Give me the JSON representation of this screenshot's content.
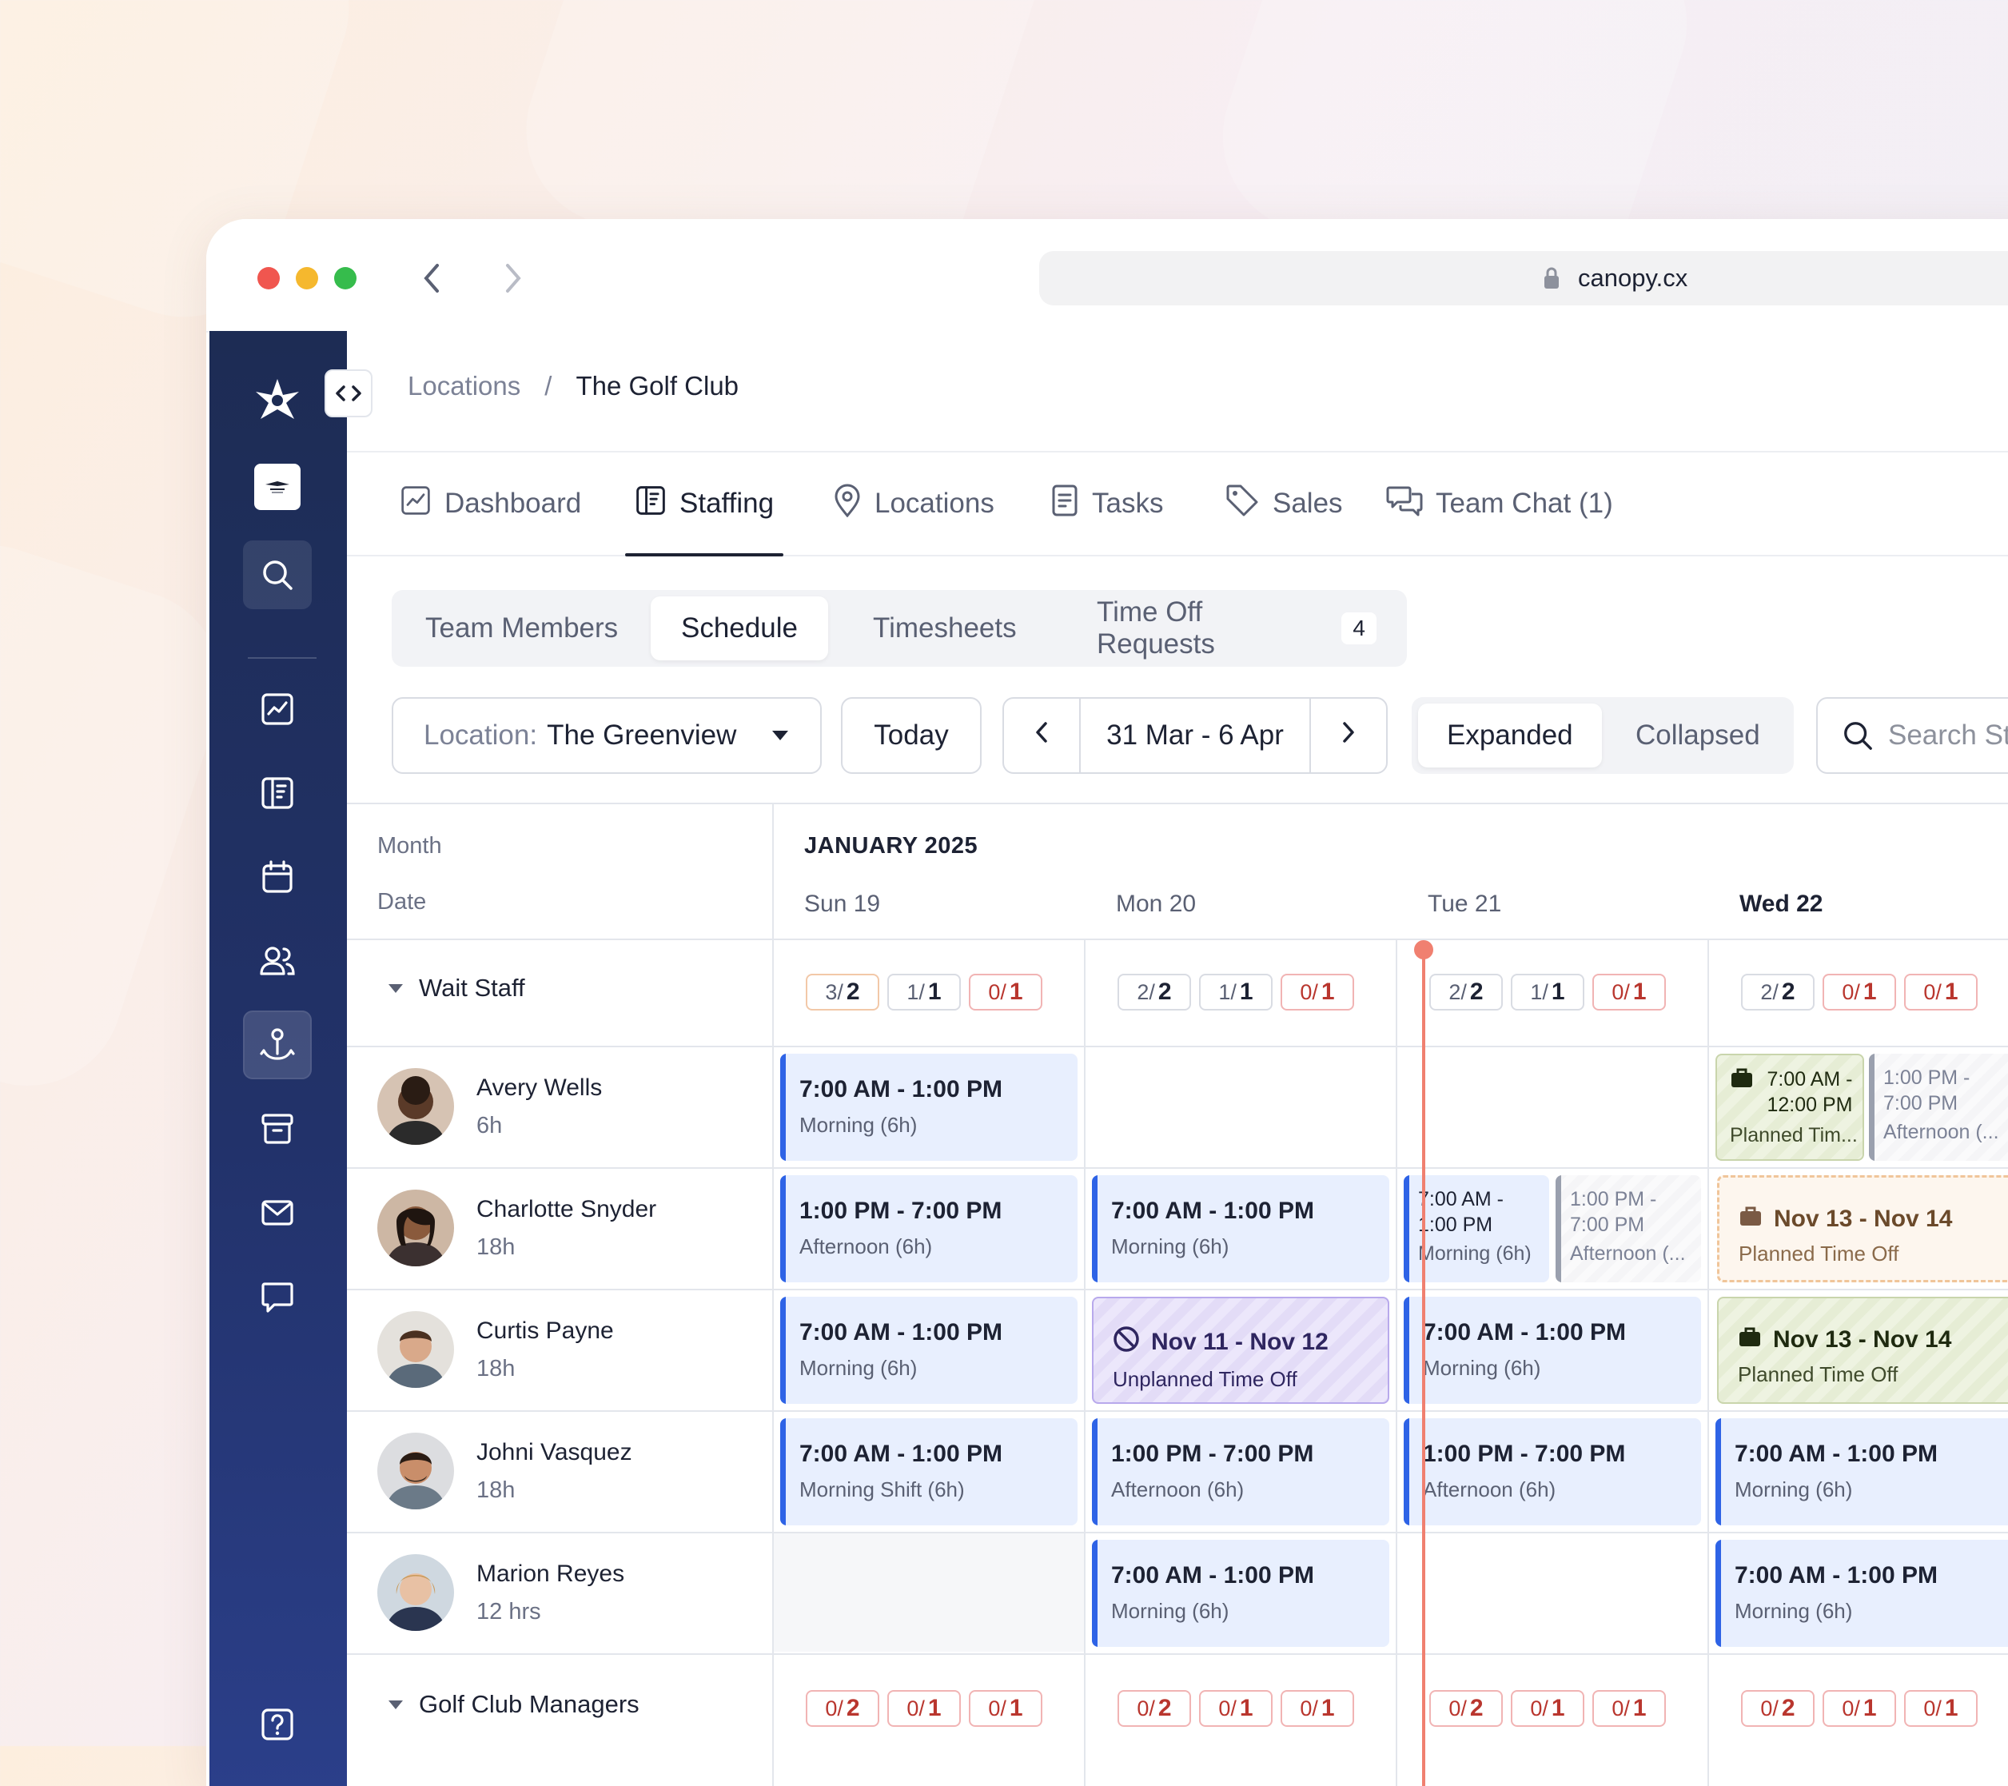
{
  "browser": {
    "url": "canopy.cx"
  },
  "breadcrumb": {
    "parent": "Locations",
    "separator": "/",
    "current": "The Golf Club"
  },
  "nav_tabs": [
    {
      "label": "Dashboard",
      "icon": "chart-icon"
    },
    {
      "label": "Staffing",
      "icon": "staffing-icon",
      "active": true
    },
    {
      "label": "Locations",
      "icon": "pin-icon"
    },
    {
      "label": "Tasks",
      "icon": "document-icon"
    },
    {
      "label": "Sales",
      "icon": "tag-icon"
    },
    {
      "label": "Team Chat (1)",
      "icon": "chat-icon"
    }
  ],
  "sub_tabs": {
    "team_members": "Team Members",
    "schedule": "Schedule",
    "timesheets": "Timesheets",
    "time_off": "Time Off Requests",
    "time_off_count": "4"
  },
  "controls": {
    "location_label": "Location:",
    "location_value": "The Greenview",
    "today": "Today",
    "date_range": "31 Mar - 6 Apr",
    "view_expanded": "Expanded",
    "view_collapsed": "Collapsed",
    "search_placeholder": "Search St"
  },
  "grid": {
    "month_label": "Month",
    "date_label": "Date",
    "month": "JANUARY 2025",
    "days": [
      "Sun 19",
      "Mon 20",
      "Tue 21",
      "Wed 22"
    ]
  },
  "groups": [
    {
      "name": "Wait Staff",
      "counts": [
        [
          {
            "a": "3",
            "b": "2"
          },
          {
            "a": "1",
            "b": "1"
          },
          {
            "a": "0",
            "b": "1"
          }
        ],
        [
          {
            "a": "2",
            "b": "2"
          },
          {
            "a": "1",
            "b": "1"
          },
          {
            "a": "0",
            "b": "1"
          }
        ],
        [
          {
            "a": "2",
            "b": "2"
          },
          {
            "a": "1",
            "b": "1"
          },
          {
            "a": "0",
            "b": "1"
          }
        ],
        [
          {
            "a": "2",
            "b": "2"
          },
          {
            "a": "0",
            "b": "1"
          },
          {
            "a": "0",
            "b": "1"
          }
        ]
      ]
    },
    {
      "name": "Golf Club Managers",
      "counts": [
        [
          {
            "a": "0",
            "b": "2"
          },
          {
            "a": "0",
            "b": "1"
          },
          {
            "a": "0",
            "b": "1"
          }
        ],
        [
          {
            "a": "0",
            "b": "2"
          },
          {
            "a": "0",
            "b": "1"
          },
          {
            "a": "0",
            "b": "1"
          }
        ],
        [
          {
            "a": "0",
            "b": "2"
          },
          {
            "a": "0",
            "b": "1"
          },
          {
            "a": "0",
            "b": "1"
          }
        ],
        [
          {
            "a": "0",
            "b": "2"
          },
          {
            "a": "0",
            "b": "1"
          },
          {
            "a": "0",
            "b": "1"
          }
        ]
      ]
    }
  ],
  "staff": [
    {
      "name": "Avery Wells",
      "hours": "6h"
    },
    {
      "name": "Charlotte Snyder",
      "hours": "18h"
    },
    {
      "name": "Curtis Payne",
      "hours": "18h"
    },
    {
      "name": "Johni Vasquez",
      "hours": "18h"
    },
    {
      "name": "Marion Reyes",
      "hours": "12 hrs"
    }
  ],
  "shifts": {
    "avery_sun": {
      "time": "7:00 AM - 1:00 PM",
      "label": "Morning (6h)"
    },
    "avery_wed_a": {
      "time": "7:00 AM - 12:00 PM",
      "label": "Planned Tim..."
    },
    "avery_wed_b": {
      "time": "1:00 PM - 7:00 PM",
      "label": "Afternoon (..."
    },
    "charlotte_sun": {
      "time": "1:00 PM - 7:00 PM",
      "label": "Afternoon (6h)"
    },
    "charlotte_mon": {
      "time": "7:00 AM - 1:00 PM",
      "label": "Morning (6h)"
    },
    "charlotte_tue_a": {
      "time": "7:00 AM - 1:00 PM",
      "label": "Morning (6h)"
    },
    "charlotte_tue_b": {
      "time": "1:00 PM - 7:00 PM",
      "label": "Afternoon (..."
    },
    "charlotte_wed": {
      "time": "Nov 13 - Nov 14",
      "label": "Planned Time Off"
    },
    "curtis_sun": {
      "time": "7:00 AM - 1:00 PM",
      "label": "Morning (6h)"
    },
    "curtis_mon": {
      "time": "Nov 11 - Nov 12",
      "label": "Unplanned Time Off"
    },
    "curtis_tue": {
      "time": "7:00 AM - 1:00 PM",
      "label": "Morning (6h)"
    },
    "curtis_wed": {
      "time": "Nov 13 - Nov 14",
      "label": "Planned Time Off"
    },
    "johni_sun": {
      "time": "7:00 AM - 1:00 PM",
      "label": "Morning Shift (6h)"
    },
    "johni_mon": {
      "time": "1:00 PM - 7:00 PM",
      "label": "Afternoon (6h)"
    },
    "johni_tue": {
      "time": "1:00 PM - 7:00 PM",
      "label": "Afternoon (6h)"
    },
    "johni_wed": {
      "time": "7:00 AM - 1:00 PM",
      "label": "Morning (6h)"
    },
    "marion_mon": {
      "time": "7:00 AM - 1:00 PM",
      "label": "Morning (6h)"
    },
    "marion_wed": {
      "time": "7:00 AM - 1:00 PM",
      "label": "Morning (6h)"
    }
  },
  "colors": {
    "sidebar": "#1d2c54",
    "shift_bg": "#e8effe",
    "shift_accent": "#2e63e6",
    "now_line": "#f08070"
  }
}
